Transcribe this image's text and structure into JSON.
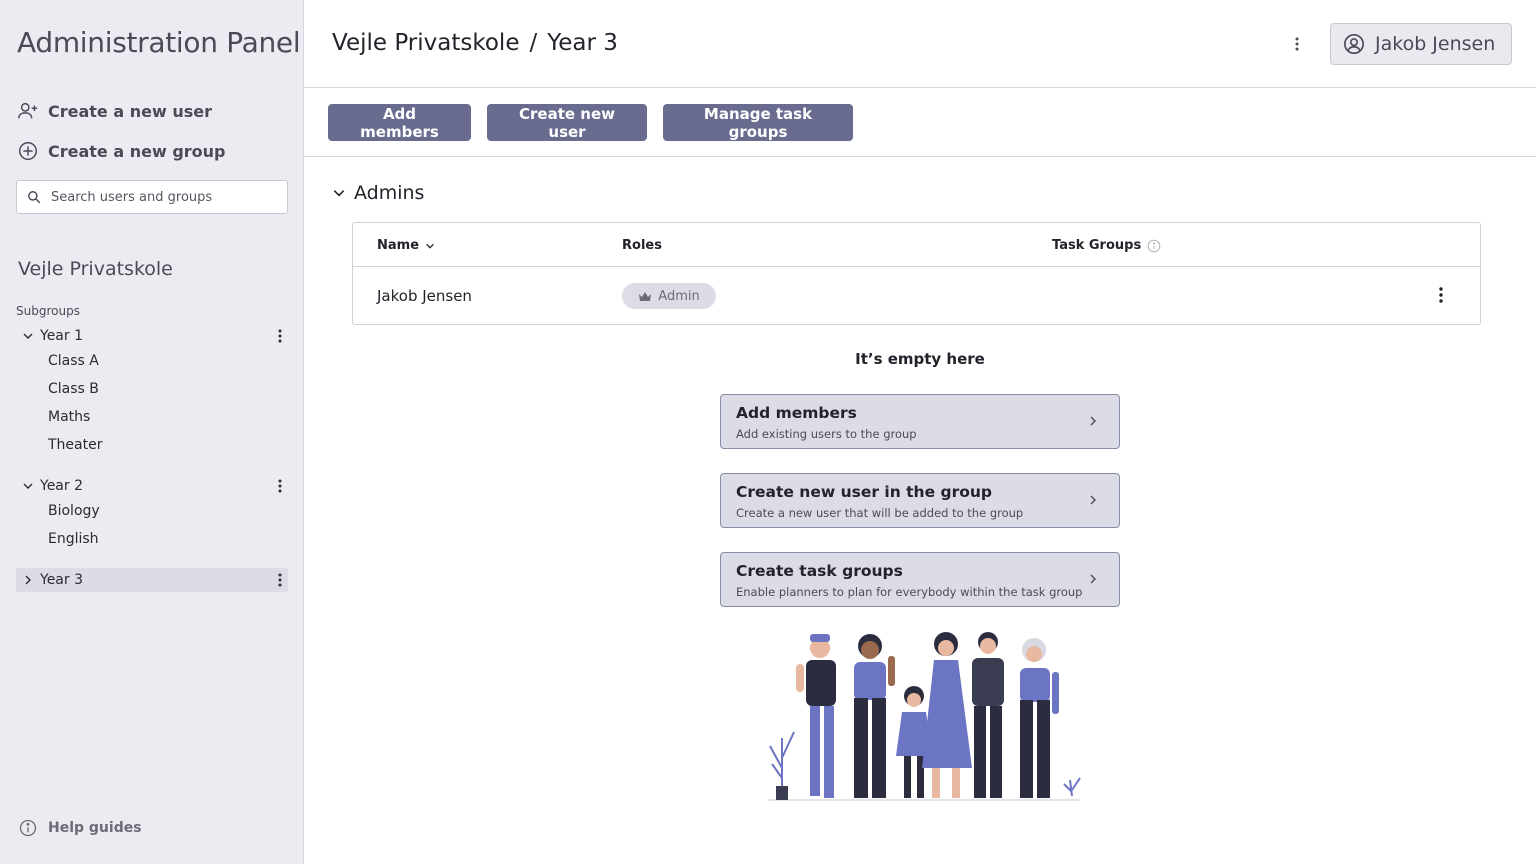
{
  "sidebar": {
    "app_title": "Administration Panel",
    "create_user": "Create a new user",
    "create_group": "Create a new group",
    "search_placeholder": "Search users and groups",
    "org_name": "Vejle Privatskole",
    "subgroups_label": "Subgroups",
    "groups": [
      {
        "label": "Year 1",
        "children": [
          "Class A",
          "Class B",
          "Maths",
          "Theater"
        ]
      },
      {
        "label": "Year 2",
        "children": [
          "Biology",
          "English"
        ]
      },
      {
        "label": "Year 3",
        "children": []
      }
    ],
    "help": "Help guides"
  },
  "header": {
    "breadcrumb_org": "Vejle Privatskole",
    "breadcrumb_sep": "/",
    "breadcrumb_group": "Year 3",
    "user_name": "Jakob Jensen"
  },
  "toolbar": {
    "add_members": "Add members",
    "create_user": "Create new user",
    "manage_task_groups": "Manage task groups"
  },
  "admins": {
    "section_title": "Admins",
    "columns": {
      "name": "Name",
      "roles": "Roles",
      "task_groups": "Task Groups"
    },
    "rows": [
      {
        "name": "Jakob Jensen",
        "role": "Admin"
      }
    ]
  },
  "empty": {
    "title": "It’s empty here",
    "cards": [
      {
        "title": "Add members",
        "subtitle": "Add existing users to the group"
      },
      {
        "title": "Create new user in the group",
        "subtitle": "Create a new user that will be added to the group"
      },
      {
        "title": "Create task groups",
        "subtitle": "Enable planners to plan for everybody within the task group"
      }
    ]
  },
  "colors": {
    "primary_button": "#6a6c8f",
    "sidebar_bg": "#ebebf1",
    "card_bg": "#dcdce6",
    "illustration": "#6c74c4"
  }
}
